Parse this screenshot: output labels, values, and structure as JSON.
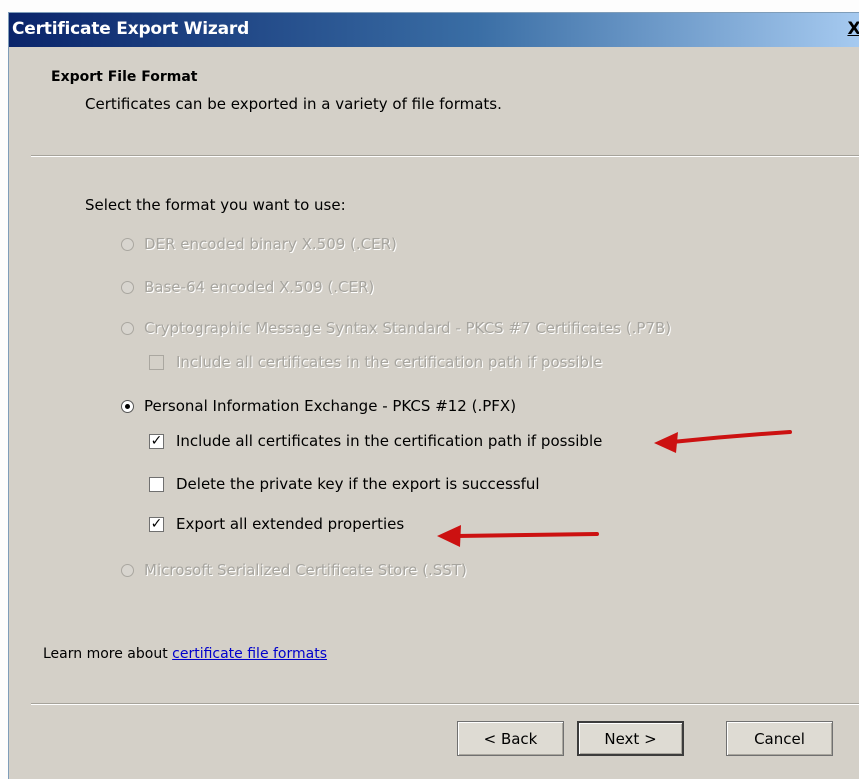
{
  "window": {
    "title": "Certificate Export Wizard",
    "close_glyph": "X"
  },
  "header": {
    "title": "Export File Format",
    "subtitle": "Certificates can be exported in a variety of file formats."
  },
  "prompt": "Select the format you want to use:",
  "options": {
    "der": {
      "label": "DER encoded binary X.509 (.CER)",
      "selected": false,
      "enabled": false
    },
    "base64": {
      "label": "Base-64 encoded X.509 (.CER)",
      "selected": false,
      "enabled": false
    },
    "pkcs7": {
      "label": "Cryptographic Message Syntax Standard - PKCS #7 Certificates (.P7B)",
      "selected": false,
      "enabled": false
    },
    "pkcs7_include": {
      "label": "Include all certificates in the certification path if possible",
      "checked": false,
      "enabled": false
    },
    "pfx": {
      "label": "Personal Information Exchange - PKCS #12 (.PFX)",
      "selected": true,
      "enabled": true
    },
    "pfx_include": {
      "label": "Include all certificates in the certification path if possible",
      "checked": true,
      "enabled": true
    },
    "pfx_delete_key": {
      "label": "Delete the private key if the export is successful",
      "checked": false,
      "enabled": true
    },
    "pfx_export_props": {
      "label": "Export all extended properties",
      "checked": true,
      "enabled": true
    },
    "sst": {
      "label": "Microsoft Serialized Certificate Store (.SST)",
      "selected": false,
      "enabled": false
    }
  },
  "learn_more": {
    "prefix": "Learn more about ",
    "link": "certificate file formats"
  },
  "buttons": {
    "back": "< Back",
    "next": "Next >",
    "cancel": "Cancel"
  },
  "annotation_color": "#cc1111"
}
